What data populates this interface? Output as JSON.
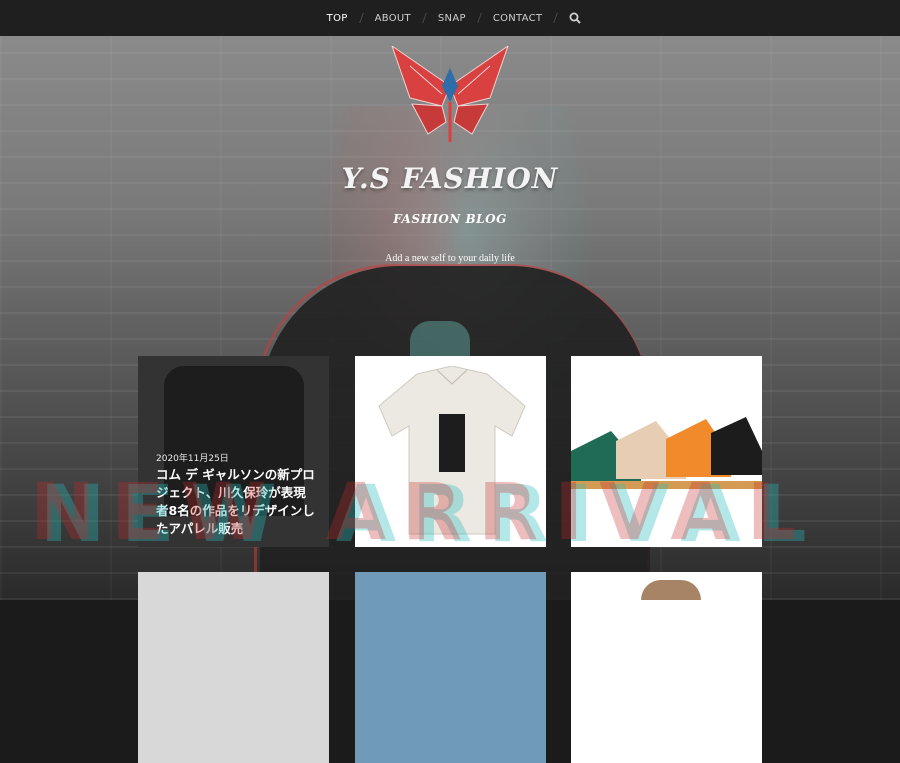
{
  "nav": {
    "items": [
      {
        "label": "TOP",
        "active": true
      },
      {
        "label": "ABOUT",
        "active": false
      },
      {
        "label": "SNAP",
        "active": false
      },
      {
        "label": "CONTACT",
        "active": false
      }
    ],
    "search_icon": "search-icon"
  },
  "hero": {
    "logo": "butterfly-logo",
    "title": "Y.S FASHION",
    "subtitle": "FASHION BLOG",
    "tagline": "Add a new self to your daily life",
    "background_text": "NEW ARRIVAL"
  },
  "posts": [
    {
      "date": "2020年11月25日",
      "title": "コム デ ギャルソンの新プロジェクト、川久保玲が表現者8名の作品をリデザインしたアパレル販売",
      "image": "black-jacket"
    },
    {
      "date": "",
      "title": "",
      "image": "white-shirt"
    },
    {
      "date": "",
      "title": "",
      "image": "sneakers"
    },
    {
      "date": "",
      "title": "",
      "image": "white-item"
    },
    {
      "date": "",
      "title": "",
      "image": "hat-person"
    },
    {
      "date": "",
      "title": "",
      "image": "bucket-hat"
    }
  ],
  "colors": {
    "nav_bg": "#1f1f1f",
    "accent_red": "#d94040",
    "accent_cyan": "#46c8c8"
  }
}
